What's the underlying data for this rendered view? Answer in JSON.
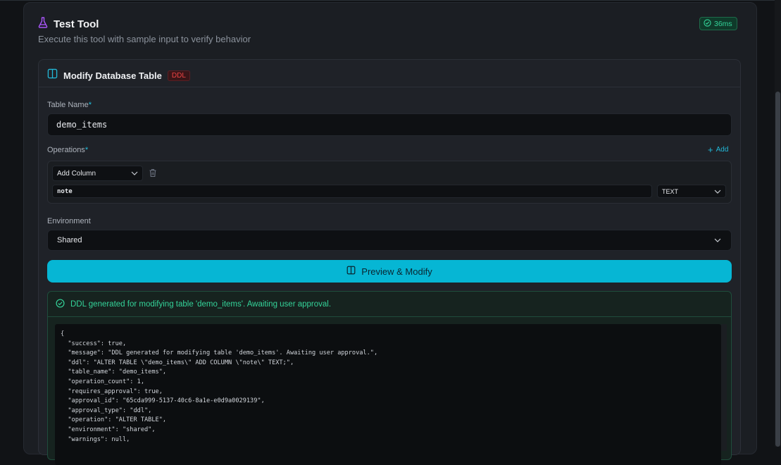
{
  "header": {
    "title": "Test Tool",
    "subtitle": "Execute this tool with sample input to verify behavior",
    "timing": "36ms"
  },
  "panel": {
    "title": "Modify Database Table",
    "badge": "DDL"
  },
  "form": {
    "table_name_label": "Table Name",
    "table_name_value": "demo_items",
    "operations_label": "Operations",
    "add_label": "Add",
    "operation_type": "Add Column",
    "column_name": "note",
    "column_type": "TEXT",
    "environment_label": "Environment",
    "environment_value": "Shared",
    "required_mark": "*"
  },
  "actions": {
    "preview_label": "Preview & Modify"
  },
  "result": {
    "message": "DDL generated for modifying table 'demo_items'. Awaiting user approval.",
    "json_lines": [
      "{",
      "  \"success\": true,",
      "  \"message\": \"DDL generated for modifying table 'demo_items'. Awaiting user approval.\",",
      "  \"ddl\": \"ALTER TABLE \\\"demo_items\\\" ADD COLUMN \\\"note\\\" TEXT;\",",
      "  \"table_name\": \"demo_items\",",
      "  \"operation_count\": 1,",
      "  \"requires_approval\": true,",
      "  \"approval_id\": \"65cda999-5137-40c6-8a1e-e0d9a0029139\",",
      "  \"approval_type\": \"ddl\",",
      "  \"operation\": \"ALTER TABLE\",",
      "  \"environment\": \"shared\",",
      "  \"warnings\": null,"
    ]
  },
  "colors": {
    "accent": "#06b6d4",
    "success": "#34d399",
    "danger": "#ef4444",
    "flask": "#a855f7"
  }
}
